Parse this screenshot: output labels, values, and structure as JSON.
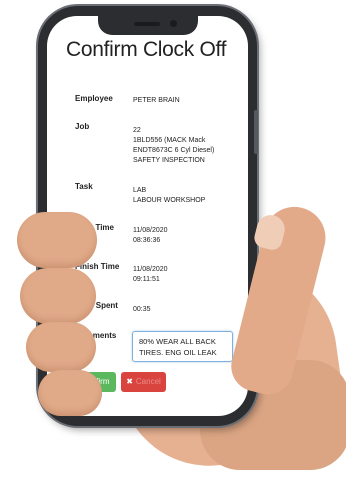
{
  "screen": {
    "title": "Confirm Clock Off",
    "rows": [
      {
        "label": "Employee",
        "lines": [
          "PETER BRAIN"
        ]
      },
      {
        "label": "Job",
        "lines": [
          "22",
          "1BLD556 (MACK Mack",
          "ENDT8673C 6 Cyl Diesel)",
          "SAFETY INSPECTION"
        ]
      },
      {
        "label": "Task",
        "lines": [
          "LAB",
          "LABOUR WORKSHOP"
        ]
      },
      {
        "label": "Start Time",
        "lines": [
          "11/08/2020",
          "08:36:36"
        ]
      },
      {
        "label": "Finish Time",
        "lines": [
          "11/08/2020",
          "09:11:51"
        ]
      },
      {
        "label": "Time Spent",
        "lines": [
          "00:35"
        ]
      }
    ],
    "comments": {
      "label": "Comments",
      "value": "80% WEAR ALL BACK TIRES. ENG OIL LEAK"
    },
    "buttons": {
      "confirm_label": "Confirm",
      "cancel_icon": "✖",
      "cancel_label": "Cancel"
    }
  },
  "colors": {
    "confirm": "#5cb85c",
    "cancel": "#d9443f",
    "input_focus_border": "#7fb0e0",
    "phone_frame": "#2b2d31"
  },
  "icons": {
    "cancel": "close-icon"
  }
}
